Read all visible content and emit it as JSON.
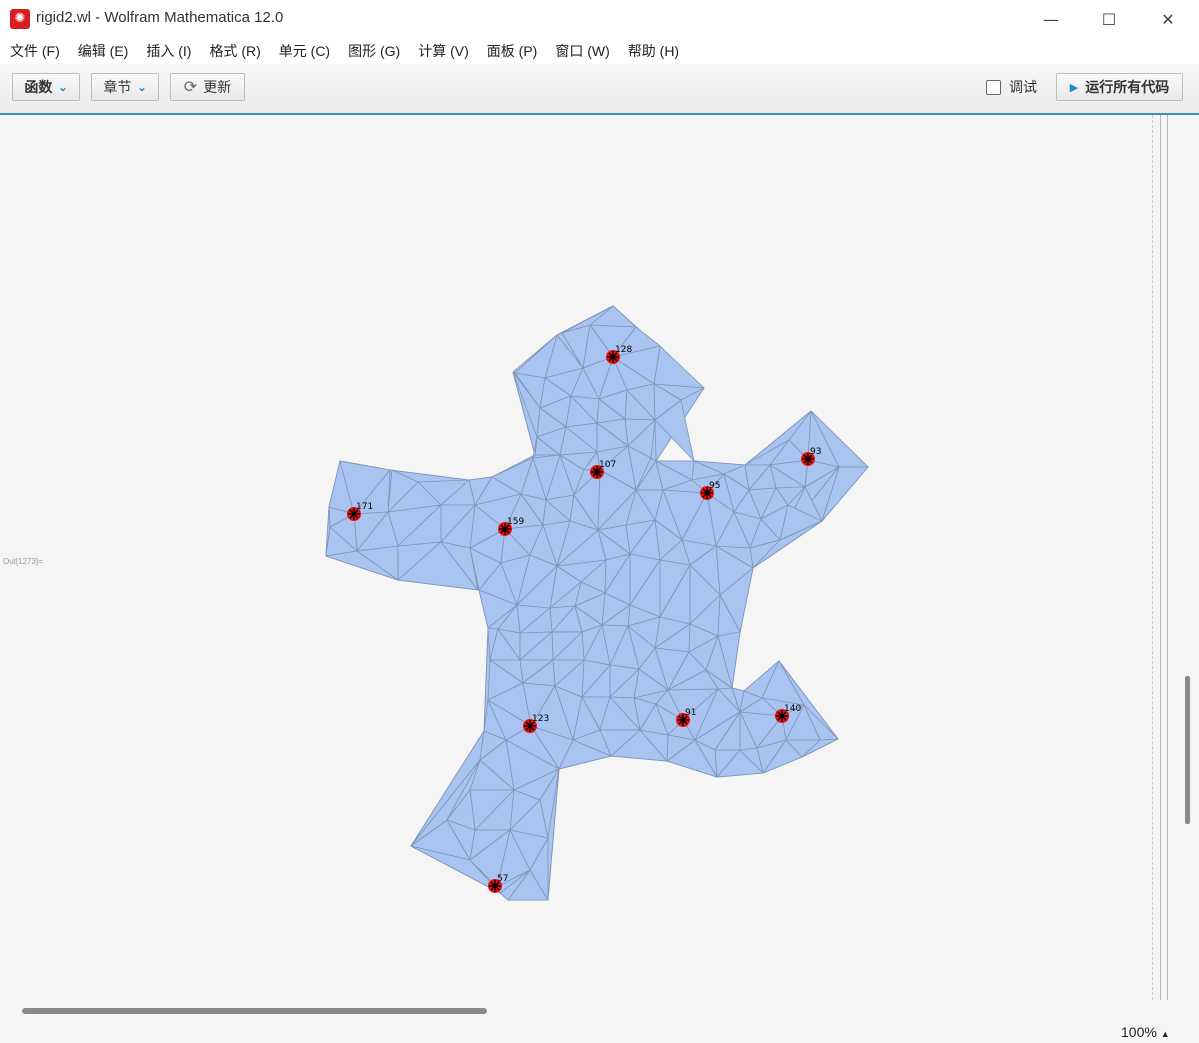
{
  "window": {
    "title": "rigid2.wl - Wolfram Mathematica 12.0",
    "minimize_glyph": "—",
    "maximize_glyph": "☐",
    "close_glyph": "✕",
    "app_icon": "mathematica-spikey-icon",
    "app_icon_glyph": "✺"
  },
  "menu": [
    "文件 (F)",
    "编辑 (E)",
    "插入 (I)",
    "格式 (R)",
    "单元 (C)",
    "图形 (G)",
    "计算 (V)",
    "面板 (P)",
    "窗口 (W)",
    "帮助 (H)"
  ],
  "toolbar": {
    "functions_label": "函数",
    "sections_label": "章节",
    "update_label": "更新",
    "debug_label": "调试",
    "run_all_label": "运行所有代码",
    "chevron_glyph": "⌄",
    "refresh_glyph": "⟳",
    "play_glyph": "▶"
  },
  "notebook": {
    "out_label": "Out[1273]=",
    "mesh_fill": "#a9c4f0",
    "mesh_edge": "#7f95b8",
    "marker_color": "#e01010",
    "anchor_points": [
      {
        "label": "128"
      },
      {
        "label": "107"
      },
      {
        "label": "93"
      },
      {
        "label": "95"
      },
      {
        "label": "171"
      },
      {
        "label": "159"
      },
      {
        "label": "123"
      },
      {
        "label": "91"
      },
      {
        "label": "140"
      },
      {
        "label": "57"
      }
    ]
  },
  "status": {
    "zoom": "100%",
    "zoom_glyph": "▲"
  }
}
